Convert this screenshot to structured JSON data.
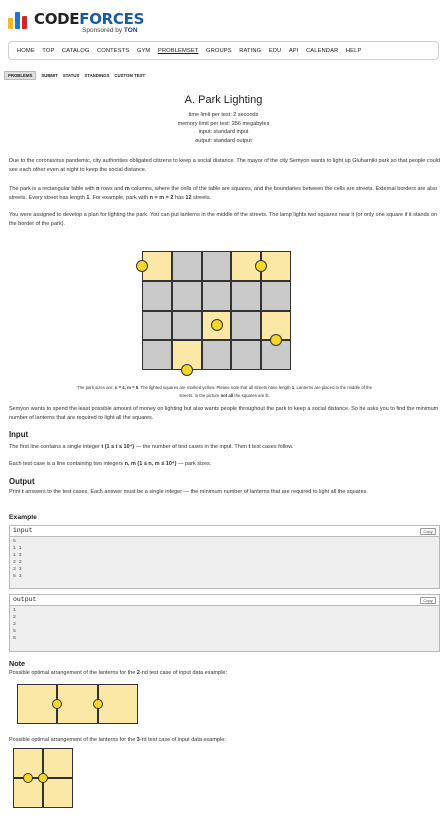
{
  "brand": {
    "name_part1": "CODE",
    "name_part2": "FORCES",
    "sponsored_prefix": "Sponsored by ",
    "sponsor_name": "TON",
    "bar_colors": [
      "#f2b829",
      "#2176c7",
      "#d3262a"
    ]
  },
  "menu": [
    "HOME",
    "TOP",
    "CATALOG",
    "CONTESTS",
    "GYM",
    "PROBLEMSET",
    "GROUPS",
    "RATING",
    "EDU",
    "API",
    "CALENDAR",
    "HELP"
  ],
  "menu_active": "PROBLEMSET",
  "submenu": [
    "PROBLEMS",
    "SUBMIT",
    "STATUS",
    "STANDINGS",
    "CUSTOM TEST"
  ],
  "submenu_active": "PROBLEMS",
  "problem": {
    "title": "A. Park Lighting",
    "time_limit": "time limit per test: 2 seconds",
    "memory_limit": "memory limit per test: 256 megabytes",
    "input": "input: standard input",
    "output": "output: standard output",
    "p1": "Due to the coronavirus pandemic, city authorities obligated citizens to keep a social distance. The mayor of the city Semyon wants to light up Gluharniki park so that people could see each other even at night to keep the social distance.",
    "p2a": "The park is a rectangular table with ",
    "p2_n": "n",
    "p2b": " rows and ",
    "p2_m": "m",
    "p2c": " columns, where the cells of the table are squares, and the boundaries between the cells are streets. External borders are also streets. Every street has length ",
    "p2_one": "1",
    "p2d": ". For example, park with ",
    "p2_eq": "n = m = 2",
    "p2e": " has ",
    "p2_twelve": "12",
    "p2f": " streets.",
    "p3": "You were assigned to develop a plan for lighting the park. You can put lanterns in the middle of the streets. The lamp lights two squares near it (or only one square if it stands on the border of the park).",
    "caption1a": "The park sizes are: ",
    "caption1_nm": "n = 4, m = 5",
    "caption1b": ". The lighted squares are marked yellow. Please note that all streets have length ",
    "caption1_one": "1",
    "caption1c": ". Lanterns are placed in the middle of the",
    "caption2a": "streets. In the picture ",
    "caption2_bold": "not all",
    "caption2b": " the squares are lit.",
    "p4": "Semyon wants to spend the least possible amount of money on lighting but also wants people throughout the park to keep a social distance. So he asks you to find the minimum number of lanterns that are required to light all the squares.",
    "input_title": "Input",
    "input_p1a": "The first line contains a single integer ",
    "input_p1_t": "t (1 ≤ t ≤ 10⁴)",
    "input_p1b": " — the number of test cases in the input. Then ",
    "input_p1_t2": "t",
    "input_p1c": " test cases follow.",
    "input_p2a": "Each test case is a line containing two integers ",
    "input_p2_nm": "n, m (1 ≤ n, m ≤ 10⁴)",
    "input_p2b": " — park sizes.",
    "output_title": "Output",
    "output_pa": "Print ",
    "output_p_t": "t",
    "output_pb": " answers to the test cases. Each answer must be a single integer — the minimum number of lanterns that are required to light all the squares.",
    "example_title": "Example",
    "example_input_label": "input",
    "example_output_label": "output",
    "copy_label": "Copy",
    "example_input_lines": [
      "5",
      "1 1",
      "1 3",
      "2 2",
      "3 3",
      "5 3"
    ],
    "example_output_lines": [
      "1",
      "2",
      "2",
      "5",
      "8"
    ],
    "note_title": "Note",
    "note1a": "Possible optimal arrangement of the lanterns for the ",
    "note1_num": "2",
    "note1_suffix": "-nd",
    "note1b": " test case of input data example:",
    "note2a": "Possible optimal arrangement of the lanterns for the ",
    "note2_num": "3",
    "note2_suffix": "-rd",
    "note2b": " test case of input data example:"
  },
  "colors": {
    "lit": "#fbe8a6",
    "dark": "#c9c9c9",
    "lamp": "#f4d72a",
    "border": "#333333"
  }
}
